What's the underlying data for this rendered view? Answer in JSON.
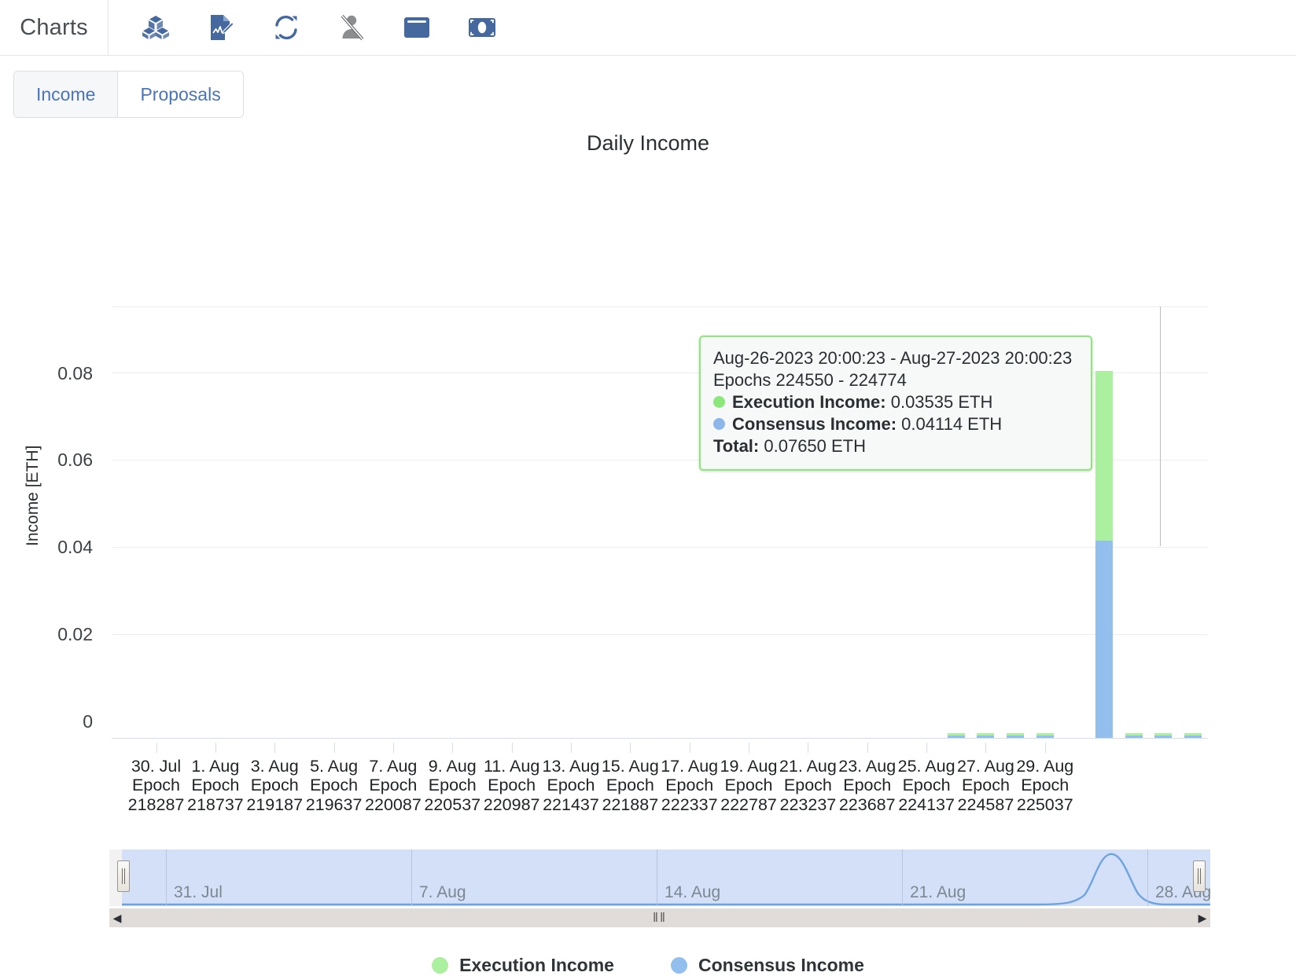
{
  "header": {
    "brand": "Charts",
    "tools": [
      {
        "name": "blocks-icon",
        "label": "Blocks"
      },
      {
        "name": "attestations-icon",
        "label": "Attestations"
      },
      {
        "name": "sync-icon",
        "label": "Sync Committee"
      },
      {
        "name": "slashings-icon",
        "label": "Slashings"
      },
      {
        "name": "wallet-icon",
        "label": "Wallet"
      },
      {
        "name": "income-icon",
        "label": "Income"
      }
    ]
  },
  "tabs": [
    {
      "label": "Income",
      "active": true
    },
    {
      "label": "Proposals",
      "active": false
    }
  ],
  "tooltip": {
    "date_range": "Aug-26-2023 20:00:23 - Aug-27-2023 20:00:23",
    "epoch_range": "Epochs 224550 - 224774",
    "execution_label": "Execution Income:",
    "execution_value": "0.03535 ETH",
    "consensus_label": "Consensus Income:",
    "consensus_value": "0.04114 ETH",
    "total_label": "Total:",
    "total_value": "0.07650 ETH"
  },
  "navigator": {
    "labels": [
      "31. Jul",
      "7. Aug",
      "14. Aug",
      "21. Aug",
      "28. Aug"
    ],
    "left_handle": "navigator-left-handle",
    "right_handle": "navigator-right-handle"
  },
  "scrollbar": {
    "left_arrow": "◀",
    "right_arrow": "▶",
    "grip": "‖‖"
  },
  "colors": {
    "execution": "#aaf09f",
    "consensus": "#93bfef",
    "tooltip_border": "#8de87a",
    "accent_blue": "#4a74b8",
    "navigator_selected": "#d3e0f7"
  },
  "chart_data": {
    "type": "bar",
    "stacked": true,
    "title": "Daily Income",
    "xlabel": "",
    "ylabel": "Income [ETH]",
    "ylim": [
      0,
      0.09
    ],
    "yticks": [
      0,
      0.02,
      0.04,
      0.06,
      0.08
    ],
    "ytick_labels": [
      "0",
      "0.02",
      "0.04",
      "0.06",
      "0.08"
    ],
    "grid": true,
    "legend_position": "bottom",
    "series": [
      {
        "name": "Execution Income",
        "color": "#aaf09f",
        "values": [
          0,
          0,
          0,
          0,
          0,
          0,
          0,
          0,
          0,
          0,
          0,
          0,
          0,
          0,
          0,
          0,
          0,
          0,
          0,
          0,
          0,
          0,
          0,
          0,
          0,
          0,
          0,
          0,
          0.0001,
          0.0002,
          0.0002,
          0.0002,
          0,
          0.03535,
          0.0001,
          0.0002,
          0.0001
        ]
      },
      {
        "name": "Consensus Income",
        "color": "#93bfef",
        "values": [
          0,
          0,
          0,
          0,
          0,
          0,
          0,
          0,
          0,
          0,
          0,
          0,
          0,
          0,
          0,
          0,
          0,
          0,
          0,
          0,
          0,
          0,
          0,
          0,
          0,
          0,
          0,
          0,
          0.0004,
          0.0005,
          0.0005,
          0.0005,
          0,
          0.04114,
          0.0004,
          0.0005,
          0.0004
        ]
      }
    ],
    "xtick_labels": [
      {
        "date": "30. Jul",
        "epoch_word": "Epoch",
        "epoch": "218287"
      },
      {
        "date": "1. Aug",
        "epoch_word": "Epoch",
        "epoch": "218737"
      },
      {
        "date": "3. Aug",
        "epoch_word": "Epoch",
        "epoch": "219187"
      },
      {
        "date": "5. Aug",
        "epoch_word": "Epoch",
        "epoch": "219637"
      },
      {
        "date": "7. Aug",
        "epoch_word": "Epoch",
        "epoch": "220087"
      },
      {
        "date": "9. Aug",
        "epoch_word": "Epoch",
        "epoch": "220537"
      },
      {
        "date": "11. Aug",
        "epoch_word": "Epoch",
        "epoch": "220987"
      },
      {
        "date": "13. Aug",
        "epoch_word": "Epoch",
        "epoch": "221437"
      },
      {
        "date": "15. Aug",
        "epoch_word": "Epoch",
        "epoch": "221887"
      },
      {
        "date": "17. Aug",
        "epoch_word": "Epoch",
        "epoch": "222337"
      },
      {
        "date": "19. Aug",
        "epoch_word": "Epoch",
        "epoch": "222787"
      },
      {
        "date": "21. Aug",
        "epoch_word": "Epoch",
        "epoch": "223237"
      },
      {
        "date": "23. Aug",
        "epoch_word": "Epoch",
        "epoch": "223687"
      },
      {
        "date": "25. Aug",
        "epoch_word": "Epoch",
        "epoch": "224137"
      },
      {
        "date": "27. Aug",
        "epoch_word": "Epoch",
        "epoch": "224587"
      },
      {
        "date": "29. Aug",
        "epoch_word": "Epoch",
        "epoch": "225037"
      }
    ],
    "legend": [
      {
        "label": "Execution Income",
        "color": "#aaf09f"
      },
      {
        "label": "Consensus Income",
        "color": "#93bfef"
      }
    ]
  }
}
